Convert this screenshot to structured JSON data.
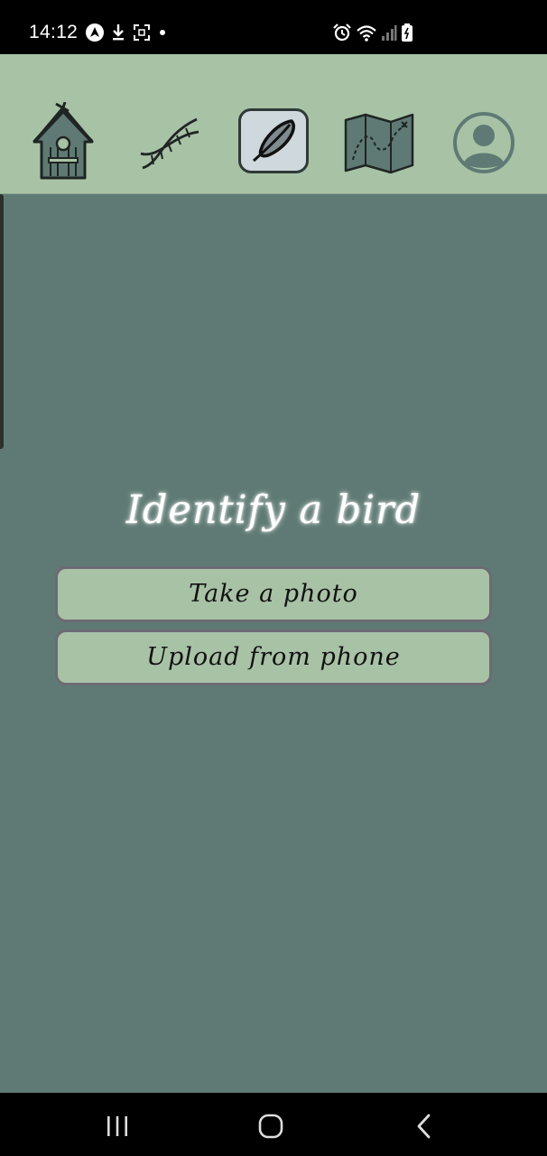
{
  "status_bar": {
    "time": "14:12",
    "left_icons": [
      "nav-arrow-icon",
      "download-icon",
      "screenshot-icon",
      "dot-icon"
    ],
    "right_icons": [
      "alarm-icon",
      "wifi-icon",
      "signal-icon",
      "battery-icon"
    ]
  },
  "top_nav": {
    "items": [
      {
        "name": "birdhouse",
        "icon": "birdhouse-icon",
        "active": false
      },
      {
        "name": "dna",
        "icon": "dna-icon",
        "active": false
      },
      {
        "name": "feather",
        "icon": "feather-icon",
        "active": true
      },
      {
        "name": "map",
        "icon": "map-icon",
        "active": false
      },
      {
        "name": "profile",
        "icon": "profile-icon",
        "active": false
      }
    ]
  },
  "main": {
    "title": "Identify a bird",
    "buttons": {
      "take_photo": "Take a photo",
      "upload": "Upload from phone"
    }
  },
  "system_nav": {
    "buttons": [
      "recent-apps-icon",
      "home-icon",
      "back-icon"
    ]
  },
  "colors": {
    "nav_background": "#a8c2a6",
    "main_background": "#5f7a74",
    "button_background": "#a8c2a6",
    "button_border": "#6d6a73",
    "active_tab_background": "#cfd8dc",
    "title_text": "#ffffff",
    "system_bars": "#000000"
  }
}
